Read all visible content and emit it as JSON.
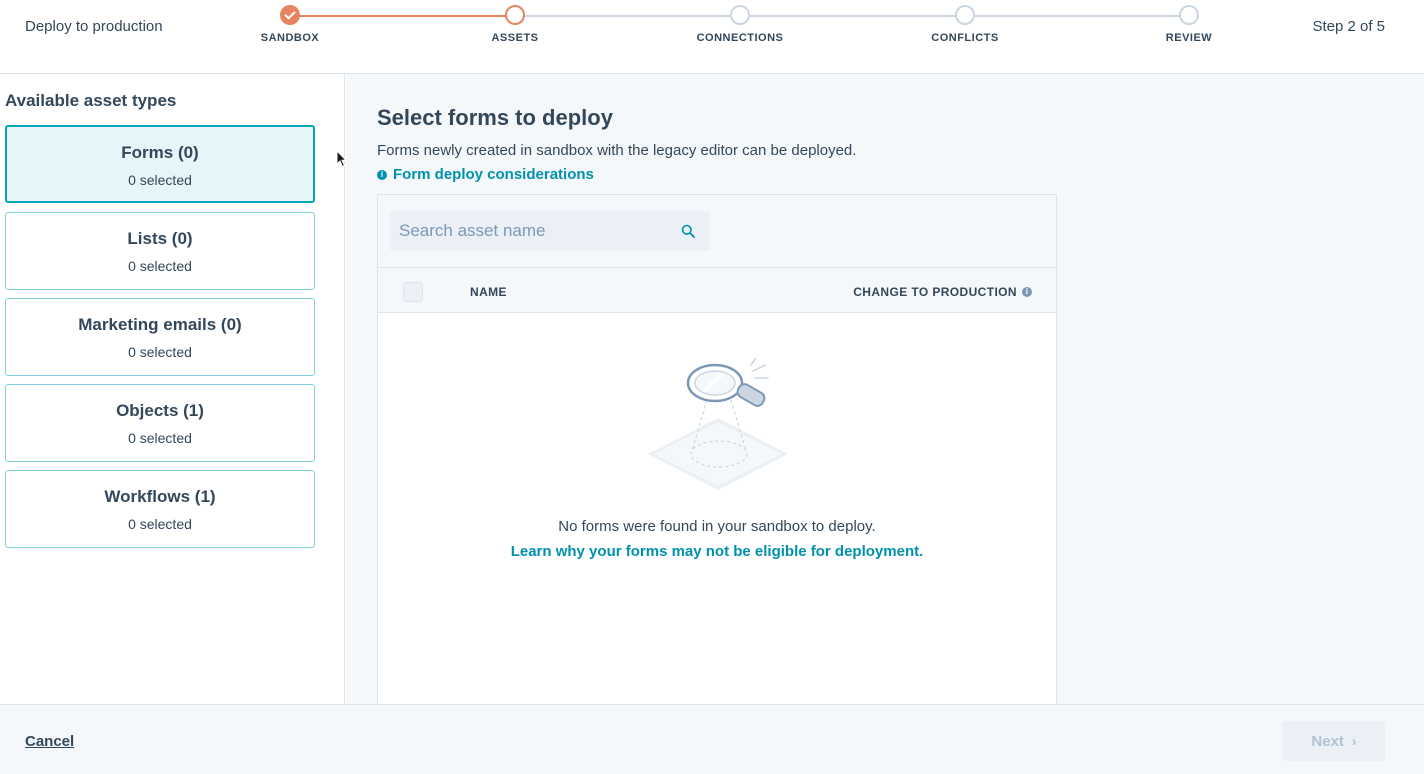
{
  "header": {
    "title": "Deploy to production",
    "step_count": "Step 2 of 5",
    "steps": [
      {
        "label": "SANDBOX",
        "state": "done"
      },
      {
        "label": "ASSETS",
        "state": "active"
      },
      {
        "label": "CONNECTIONS",
        "state": "todo"
      },
      {
        "label": "CONFLICTS",
        "state": "todo"
      },
      {
        "label": "REVIEW",
        "state": "todo"
      }
    ]
  },
  "sidebar": {
    "title": "Available asset types",
    "items": [
      {
        "title": "Forms (0)",
        "subtitle": "0 selected",
        "selected": true
      },
      {
        "title": "Lists (0)",
        "subtitle": "0 selected",
        "selected": false
      },
      {
        "title": "Marketing emails (0)",
        "subtitle": "0 selected",
        "selected": false
      },
      {
        "title": "Objects (1)",
        "subtitle": "0 selected",
        "selected": false
      },
      {
        "title": "Workflows (1)",
        "subtitle": "0 selected",
        "selected": false
      }
    ]
  },
  "main": {
    "title": "Select forms to deploy",
    "description": "Forms newly created in sandbox with the legacy editor can be deployed.",
    "considerations_link": "Form deploy considerations",
    "search": {
      "placeholder": "Search asset name",
      "value": ""
    },
    "table": {
      "columns": [
        "NAME",
        "CHANGE TO PRODUCTION"
      ],
      "rows": []
    },
    "empty_state": {
      "message": "No forms were found in your sandbox to deploy.",
      "link": "Learn why your forms may not be eligible for deployment."
    }
  },
  "footer": {
    "cancel_label": "Cancel",
    "next_label": "Next",
    "next_disabled": true
  },
  "colors": {
    "accent_orange": "#e68461",
    "link_teal": "#0091ae",
    "selected_border": "#00a4bd",
    "text": "#33475b"
  },
  "icons": [
    "check-icon",
    "info-icon",
    "search-icon",
    "chevron-right-icon",
    "magnifier-illustration",
    "mouse-cursor"
  ]
}
